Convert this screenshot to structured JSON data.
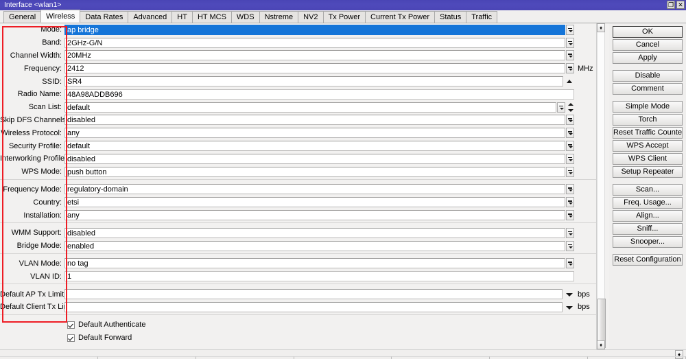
{
  "window": {
    "title": "Interface <wlan1>",
    "restore_label": "❐",
    "close_label": "✕"
  },
  "tabs": [
    {
      "label": "General",
      "active": false
    },
    {
      "label": "Wireless",
      "active": true
    },
    {
      "label": "Data Rates",
      "active": false
    },
    {
      "label": "Advanced",
      "active": false
    },
    {
      "label": "HT",
      "active": false
    },
    {
      "label": "HT MCS",
      "active": false
    },
    {
      "label": "WDS",
      "active": false
    },
    {
      "label": "Nstreme",
      "active": false
    },
    {
      "label": "NV2",
      "active": false
    },
    {
      "label": "Tx Power",
      "active": false
    },
    {
      "label": "Current Tx Power",
      "active": false
    },
    {
      "label": "Status",
      "active": false
    },
    {
      "label": "Traffic",
      "active": false
    }
  ],
  "form": {
    "rows": [
      {
        "label": "Mode:",
        "value": "ap bridge",
        "selected": true,
        "control": "dropdown"
      },
      {
        "label": "Band:",
        "value": "2GHz-G/N",
        "control": "dropdown"
      },
      {
        "label": "Channel Width:",
        "value": "20MHz",
        "control": "dropdown"
      },
      {
        "label": "Frequency:",
        "value": "2412",
        "control": "dropdown",
        "unit": "MHz"
      },
      {
        "label": "SSID:",
        "value": "SR4",
        "control": "uparrow"
      },
      {
        "label": "Radio Name:",
        "value": "48A98ADDB696",
        "control": "none"
      },
      {
        "label": "Scan List:",
        "value": "default",
        "control": "dropdown-spin"
      },
      {
        "label": "Skip DFS Channels:",
        "value": "disabled",
        "control": "dropdown"
      },
      {
        "label": "Wireless Protocol:",
        "value": "any",
        "control": "dropdown"
      },
      {
        "label": "Security Profile:",
        "value": "default",
        "control": "dropdown"
      },
      {
        "label": "Interworking Profile:",
        "value": "disabled",
        "control": "dropdown"
      },
      {
        "label": "WPS Mode:",
        "value": "push button",
        "control": "dropdown"
      },
      {
        "separator": true
      },
      {
        "label": "Frequency Mode:",
        "value": "regulatory-domain",
        "control": "dropdown"
      },
      {
        "label": "Country:",
        "value": "etsi",
        "control": "dropdown"
      },
      {
        "label": "Installation:",
        "value": "any",
        "control": "dropdown"
      },
      {
        "separator": true
      },
      {
        "label": "WMM Support:",
        "value": "disabled",
        "control": "dropdown"
      },
      {
        "label": "Bridge Mode:",
        "value": "enabled",
        "control": "dropdown"
      },
      {
        "separator": true
      },
      {
        "label": "VLAN Mode:",
        "value": "no tag",
        "control": "dropdown"
      },
      {
        "label": "VLAN ID:",
        "value": "1",
        "control": "none"
      },
      {
        "separator": true
      },
      {
        "label": "Default AP Tx Limit:",
        "value": "",
        "control": "caret",
        "unit": "bps"
      },
      {
        "label": "Default Client Tx Limit:",
        "value": "",
        "control": "caret",
        "unit": "bps"
      },
      {
        "separator": true
      }
    ],
    "checkboxes": [
      {
        "label": "Default Authenticate",
        "checked": true
      },
      {
        "label": "Default Forward",
        "checked": true
      }
    ]
  },
  "commands": [
    {
      "label": "OK",
      "default": true
    },
    {
      "label": "Cancel"
    },
    {
      "label": "Apply"
    },
    {
      "gap": true
    },
    {
      "label": "Disable"
    },
    {
      "label": "Comment"
    },
    {
      "gap": true
    },
    {
      "label": "Simple Mode"
    },
    {
      "label": "Torch"
    },
    {
      "label": "Reset Traffic Counters"
    },
    {
      "label": "WPS Accept"
    },
    {
      "label": "WPS Client"
    },
    {
      "label": "Setup Repeater"
    },
    {
      "gap": true
    },
    {
      "label": "Scan..."
    },
    {
      "label": "Freq. Usage..."
    },
    {
      "label": "Align..."
    },
    {
      "label": "Sniff..."
    },
    {
      "label": "Snooper..."
    },
    {
      "gap": true
    },
    {
      "label": "Reset Configuration"
    }
  ],
  "scrollbar": {
    "up_arrow": "♦",
    "down_arrow": "♦"
  },
  "statusbar": {
    "resize_grip": "♦"
  },
  "colors": {
    "titlebar": "#4a45b5",
    "selection_blue": "#1575d8",
    "highlight_red": "#ee1c24",
    "window_bg": "#f2f1f0"
  }
}
